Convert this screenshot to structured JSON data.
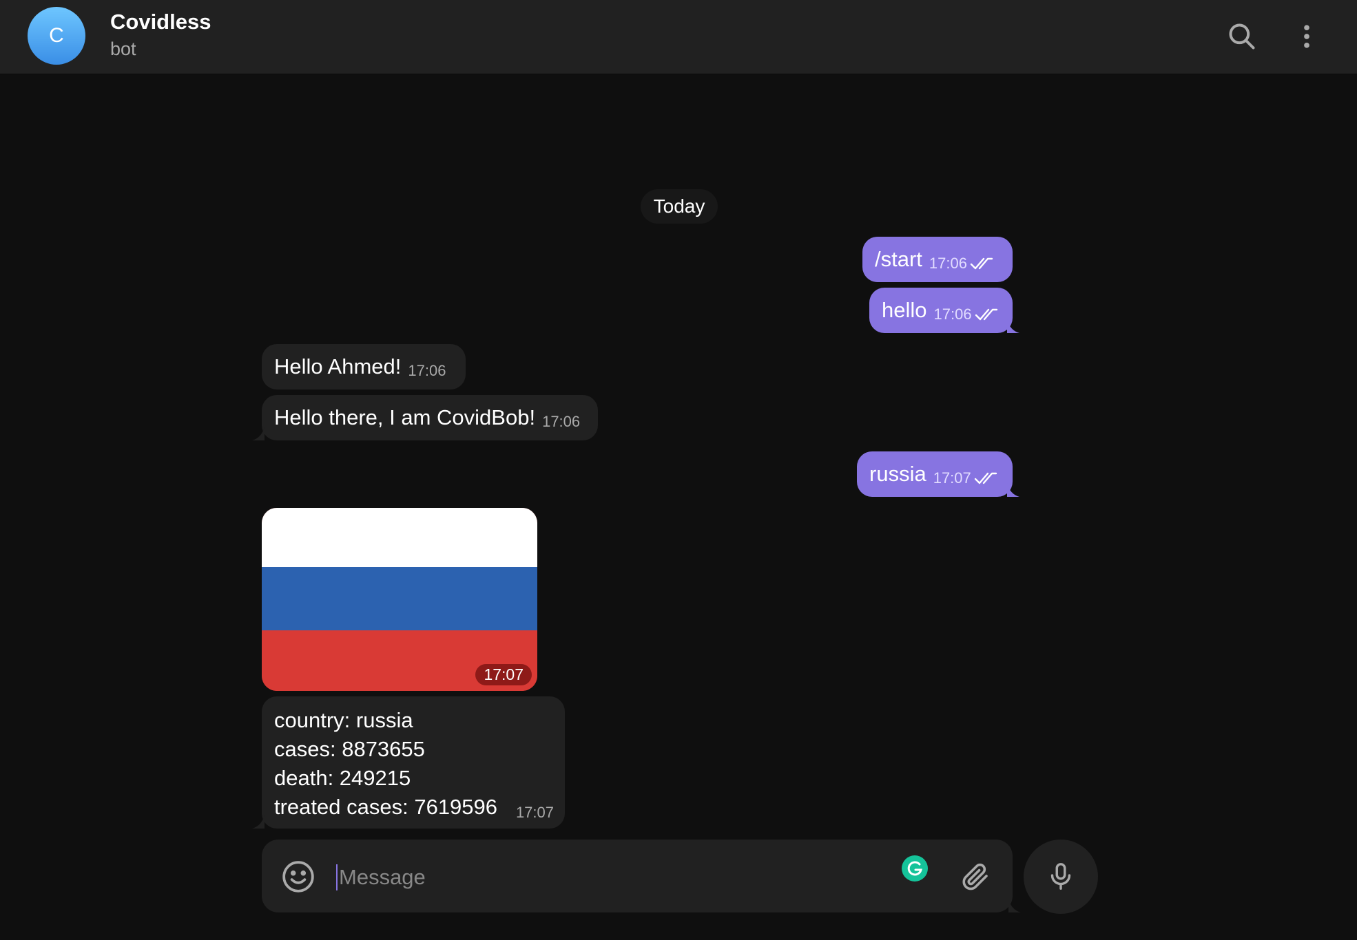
{
  "header": {
    "avatar_letter": "C",
    "title": "Covidless",
    "subtitle": "bot",
    "icons": [
      "search-icon",
      "more-vertical-icon"
    ]
  },
  "chat": {
    "date_separator": "Today",
    "messages": [
      {
        "direction": "out",
        "text": "/start",
        "time": "17:06",
        "status": "read"
      },
      {
        "direction": "out",
        "text": "hello",
        "time": "17:06",
        "status": "read"
      },
      {
        "direction": "in",
        "text": "Hello Ahmed!",
        "time": "17:06"
      },
      {
        "direction": "in",
        "text": "Hello there, I am CovidBob!",
        "time": "17:06"
      },
      {
        "direction": "out",
        "text": "russia",
        "time": "17:07",
        "status": "read"
      },
      {
        "direction": "in",
        "type": "photo",
        "photo": "russia-flag-image",
        "time": "17:07"
      },
      {
        "direction": "in",
        "lines": [
          "country: russia",
          "cases: 8873655",
          "death: 249215",
          "treated cases: 7619596"
        ],
        "time": "17:07"
      }
    ]
  },
  "composer": {
    "placeholder": "Message",
    "value": "",
    "icons": [
      "emoji-icon",
      "grammarly-icon",
      "attach-icon",
      "microphone-icon"
    ]
  },
  "colors": {
    "background": "#0f0f0f",
    "header": "#212121",
    "outgoing_bubble": "#8774e1",
    "incoming_bubble": "#212121",
    "flag_white": "#ffffff",
    "flag_blue": "#2c62b0",
    "flag_red": "#d93a35",
    "grammarly": "#15c39a"
  }
}
